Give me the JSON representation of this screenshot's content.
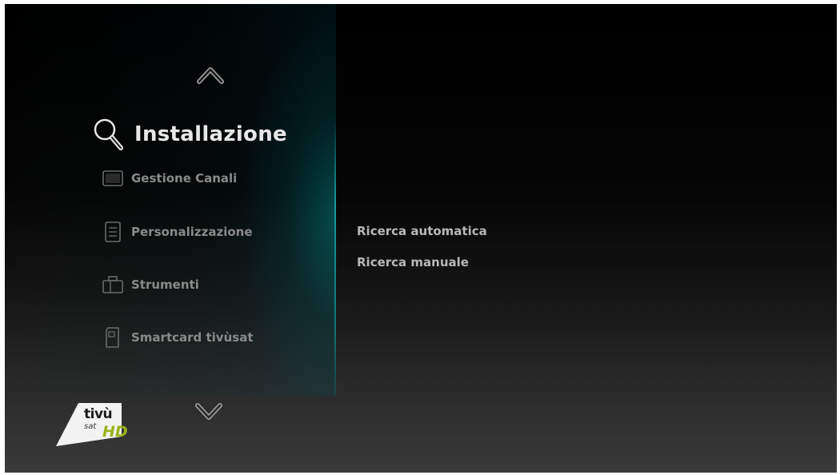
{
  "nav": {
    "up_icon": "chevron-up-icon",
    "down_icon": "chevron-down-icon"
  },
  "section": {
    "title": "Installazione",
    "icon": "search-icon"
  },
  "menu": {
    "items": [
      {
        "label": "Gestione Canali",
        "icon": "channel-list-icon"
      },
      {
        "label": "Personalizzazione",
        "icon": "settings-doc-icon"
      },
      {
        "label": "Strumenti",
        "icon": "toolbox-icon"
      },
      {
        "label": "Smartcard tivùsat",
        "icon": "smartcard-icon"
      }
    ]
  },
  "submenu": {
    "items": [
      {
        "label": "Ricerca automatica"
      },
      {
        "label": "Ricerca manuale"
      }
    ]
  },
  "logo": {
    "brand": "tivù",
    "sub": "sat",
    "badge": "HD"
  },
  "colors": {
    "accent": "#1fa5a5",
    "logo_green": "#9bb21a"
  }
}
